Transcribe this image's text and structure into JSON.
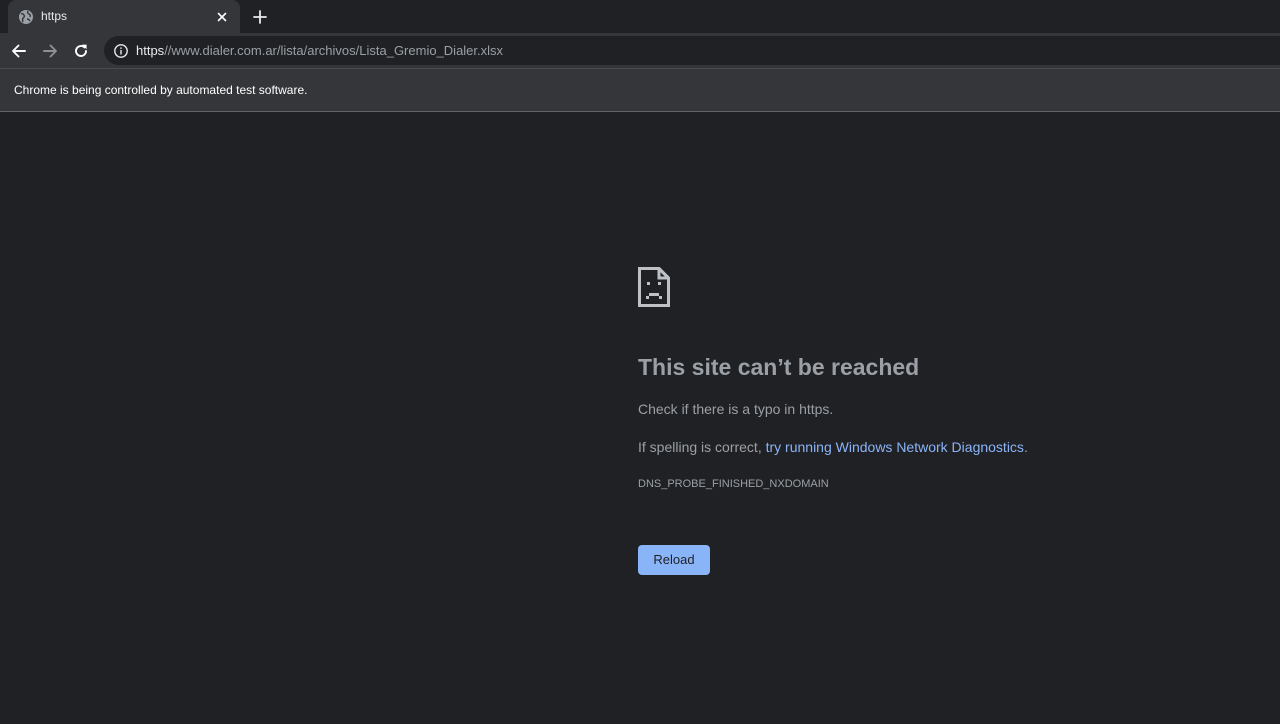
{
  "tab": {
    "title": "https",
    "favicon": "globe-icon",
    "close_icon": "close-icon"
  },
  "toolbar": {
    "back_icon": "back-arrow-icon",
    "forward_icon": "forward-arrow-icon",
    "reload_icon": "reload-icon",
    "new_tab_icon": "plus-icon",
    "info_icon": "info-icon",
    "url_scheme": "https",
    "url_rest": "//www.dialer.com.ar/lista/archivos/Lista_Gremio_Dialer.xlsx"
  },
  "infobar": {
    "text": "Chrome is being controlled by automated test software."
  },
  "error_page": {
    "icon": "sad-page-icon",
    "heading": "This site can’t be reached",
    "suggestion_1": "Check if there is a typo in https.",
    "suggestion_2_prefix": "If spelling is correct, ",
    "suggestion_2_link": "try running Windows Network Diagnostics",
    "suggestion_2_suffix": ".",
    "error_code": "DNS_PROBE_FINISHED_NXDOMAIN",
    "reload_label": "Reload"
  },
  "colors": {
    "background": "#202124",
    "toolbar": "#35363a",
    "link": "#8ab4f8",
    "muted_text": "#9aa0a6",
    "button": "#8ab4f8"
  }
}
